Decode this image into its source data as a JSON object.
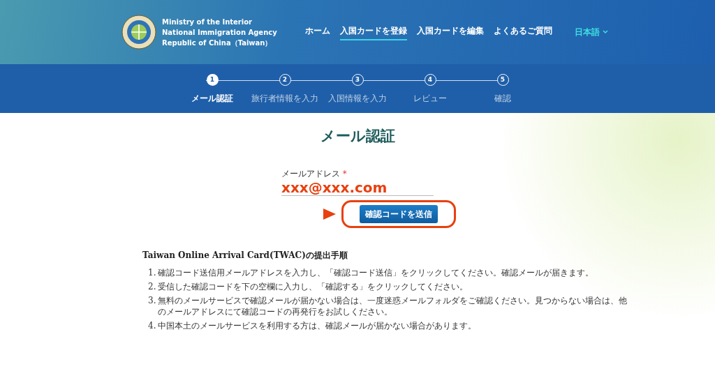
{
  "header": {
    "agency_lines": [
      "Ministry of the Interior",
      "National Immigration Agency",
      "Republic of China（Taiwan）"
    ],
    "nav": [
      {
        "label": "ホーム",
        "selected": false
      },
      {
        "label": "入国カードを登録",
        "selected": true
      },
      {
        "label": "入国カードを編集",
        "selected": false
      },
      {
        "label": "よくあるご質問",
        "selected": false
      }
    ],
    "language": "日本語"
  },
  "steps": [
    {
      "number": "1",
      "label": "メール認証",
      "selected": true
    },
    {
      "number": "2",
      "label": "旅行者情報を入力",
      "selected": false
    },
    {
      "number": "3",
      "label": "入国情報を入力",
      "selected": false
    },
    {
      "number": "4",
      "label": "レビュー",
      "selected": false
    },
    {
      "number": "5",
      "label": "確認",
      "selected": false
    }
  ],
  "form": {
    "title": "メール認証",
    "field_label": "メールアドレス",
    "required_mark": "*",
    "value": "xxx@xxx.com",
    "button": "確認コードを送信"
  },
  "instructions": {
    "title": "Taiwan Online Arrival Card(TWAC)の提出手順",
    "items": [
      {
        "number": "1.",
        "text": "確認コード送信用メールアドレスを入力し、「確認コード送信」をクリックしてください。確認メールが届きます。"
      },
      {
        "number": "2.",
        "text": "受信した確認コードを下の空欄に入力し、「確認する」をクリックしてください。"
      },
      {
        "number": "3.",
        "text": "無料のメールサービスで確認メールが届かない場合は、一度迷惑メールフォルダをご確認ください。見つからない場合は、他のメールアドレスにて確認コードの再発行をお試しください。"
      },
      {
        "number": "4.",
        "text": "中国本土のメールサービスを利用する方は、確認メールが届かない場合があります。"
      }
    ]
  }
}
